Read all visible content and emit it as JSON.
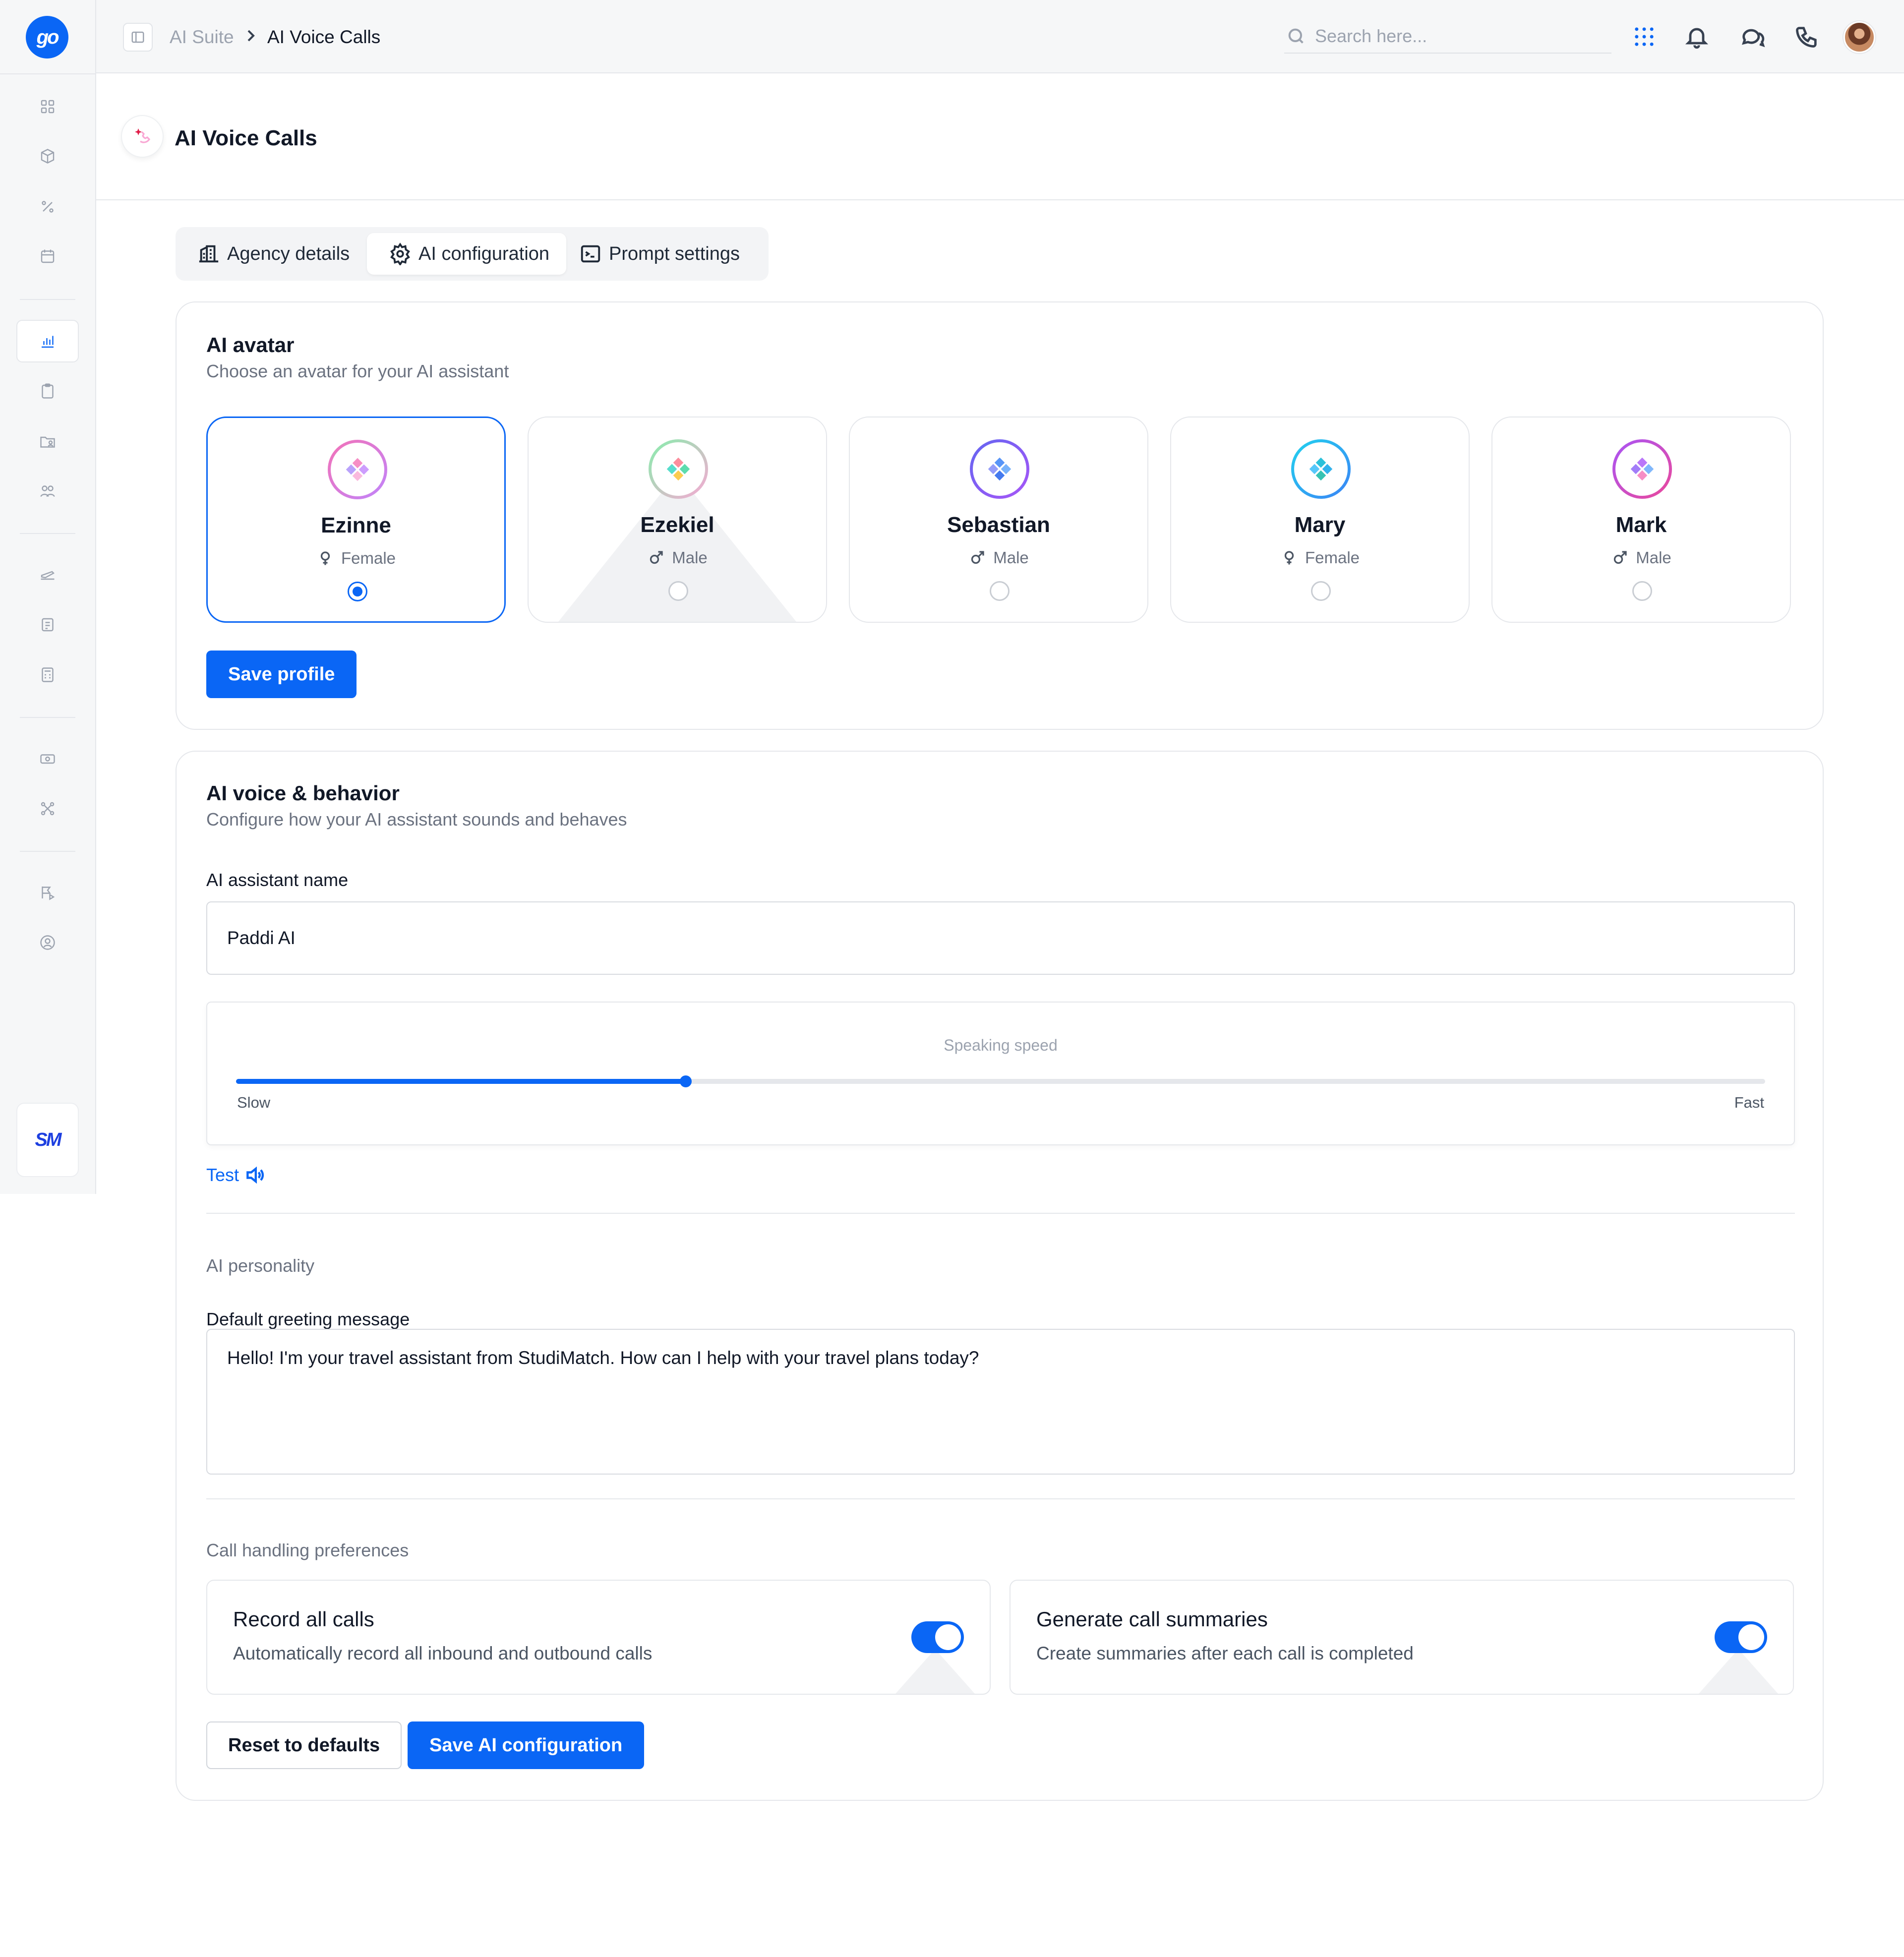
{
  "app": {
    "logo_text": "go",
    "brand_text": "SM",
    "accent_color": "#0a66f5"
  },
  "sidebar": {
    "items": [
      {
        "icon": "grid-icon",
        "active": false
      },
      {
        "icon": "box-icon",
        "active": false
      },
      {
        "icon": "percent-icon",
        "active": false
      },
      {
        "icon": "calendar-icon",
        "active": false
      },
      {
        "icon": "bar-chart-icon",
        "active": true
      },
      {
        "icon": "clipboard-icon",
        "active": false
      },
      {
        "icon": "folder-user-icon",
        "active": false
      },
      {
        "icon": "users-icon",
        "active": false
      },
      {
        "icon": "plane-icon",
        "active": false
      },
      {
        "icon": "document-icon",
        "active": false
      },
      {
        "icon": "calculator-icon",
        "active": false
      },
      {
        "icon": "banknote-icon",
        "active": false
      },
      {
        "icon": "integrations-icon",
        "active": false
      },
      {
        "icon": "flag-play-icon",
        "active": false
      },
      {
        "icon": "user-circle-icon",
        "active": false
      }
    ]
  },
  "topbar": {
    "breadcrumb_root": "AI Suite",
    "breadcrumb_current": "AI Voice Calls",
    "search_placeholder": "Search here...",
    "icons": [
      "apps-grid-icon",
      "bell-icon",
      "chat-icon",
      "phone-icon"
    ]
  },
  "page": {
    "title": "AI Voice Calls"
  },
  "tabs": [
    {
      "label": "Agency details",
      "icon": "building-icon",
      "active": false
    },
    {
      "label": "AI configuration",
      "icon": "gear-icon",
      "active": true
    },
    {
      "label": "Prompt settings",
      "icon": "terminal-icon",
      "active": false
    }
  ],
  "avatar_section": {
    "title": "AI avatar",
    "subtitle": "Choose an avatar for your AI assistant",
    "options": [
      {
        "name": "Ezinne",
        "gender": "Female",
        "selected": true,
        "ring": [
          "#f472b6",
          "#c084fc"
        ]
      },
      {
        "name": "Ezekiel",
        "gender": "Male",
        "selected": false,
        "ring": [
          "#86efac",
          "#f9a8d4"
        ]
      },
      {
        "name": "Sebastian",
        "gender": "Male",
        "selected": false,
        "ring": [
          "#6366f1",
          "#a855f7"
        ]
      },
      {
        "name": "Mary",
        "gender": "Female",
        "selected": false,
        "ring": [
          "#22d3ee",
          "#3b82f6"
        ]
      },
      {
        "name": "Mark",
        "gender": "Male",
        "selected": false,
        "ring": [
          "#a855f7",
          "#ec4899"
        ]
      }
    ],
    "save_label": "Save profile"
  },
  "voice_section": {
    "title": "AI voice & behavior",
    "subtitle": "Configure how your AI assistant sounds and behaves",
    "name_label": "AI assistant name",
    "name_value": "Paddi AI",
    "speed_title": "Speaking speed",
    "speed_min_label": "Slow",
    "speed_max_label": "Fast",
    "speed_value": 0.294,
    "test_label": "Test",
    "personality_label": "AI personality",
    "greeting_label": "Default greeting message",
    "greeting_value": "Hello! I'm your travel assistant from StudiMatch. How can I help with your travel plans today?",
    "prefs_label": "Call handling preferences",
    "prefs": [
      {
        "title": "Record all calls",
        "desc": "Automatically record all inbound and outbound calls",
        "enabled": true
      },
      {
        "title": "Generate call summaries",
        "desc": "Create summaries after each call is completed",
        "enabled": true
      }
    ],
    "reset_label": "Reset to defaults",
    "save_label": "Save AI configuration"
  }
}
